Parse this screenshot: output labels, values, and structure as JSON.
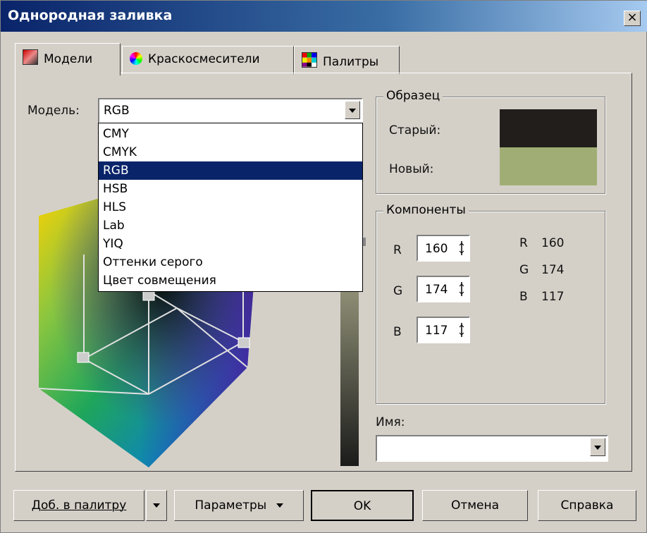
{
  "window": {
    "title": "Однородная заливка"
  },
  "tabs": [
    {
      "label": "Модели",
      "icon": "models-icon"
    },
    {
      "label": "Краскосмесители",
      "icon": "color-wheel-icon"
    },
    {
      "label": "Палитры",
      "icon": "palette-grid-icon"
    }
  ],
  "model": {
    "label": "Модель:",
    "selected": "RGB",
    "options": [
      "CMY",
      "CMYK",
      "RGB",
      "HSB",
      "HLS",
      "Lab",
      "YIQ",
      "Оттенки серого",
      "Цвет совмещения"
    ]
  },
  "sample": {
    "title": "Образец",
    "old_label": "Старый:",
    "new_label": "Новый:",
    "old_color": "#221e1b",
    "new_color": "#a0ae75"
  },
  "components": {
    "title": "Компоненты",
    "r_label": "R",
    "g_label": "G",
    "b_label": "B",
    "r_value": "160",
    "g_value": "174",
    "b_value": "117",
    "readout": [
      {
        "label": "R",
        "value": "160"
      },
      {
        "label": "G",
        "value": "174"
      },
      {
        "label": "B",
        "value": "117"
      }
    ]
  },
  "name": {
    "label": "Имя:",
    "value": ""
  },
  "buttons": {
    "add_to_palette": "Доб. в палитру",
    "parameters": "Параметры",
    "ok": "OK",
    "cancel": "Отмена",
    "help": "Справка"
  }
}
